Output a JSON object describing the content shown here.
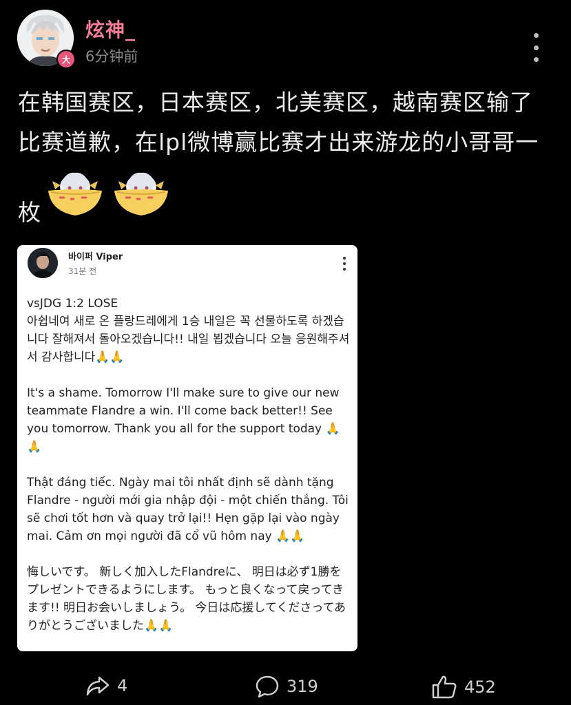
{
  "post": {
    "username": "炫神_",
    "time": "6分钟前",
    "badge": "大",
    "text": "在韩国赛区，日本赛区，北美赛区，越南赛区输了比赛道歉，在lpl微博赢比赛才出来游龙的小哥哥一",
    "text_tail": "枚",
    "emoji_icons": [
      "noodle-bowl-girl-icon",
      "noodle-bowl-girl-icon"
    ]
  },
  "card": {
    "name": "바이퍼 Viper",
    "time": "31분 전",
    "paragraphs": [
      "vsJDG 1:2 LOSE\n아쉽네여 새로 온 플랑드레에게 1승 내일은 꼭 선물하도록 하겠습니다 잘해져서 돌아오겠습니다!! 내일 뵙겠습니다 오늘 응원해주셔서 감사합니다🙏🙏",
      "It's a shame. Tomorrow I'll make sure to give our new teammate Flandre a win. I'll come back better!! See you tomorrow. Thank you all for the support today 🙏🙏",
      "Thật đáng tiếc. Ngày mai tôi nhất định sẽ dành tặng Flandre - người mới gia nhập đội - một chiến thắng. Tôi sẽ chơi tốt hơn và quay trở lại!! Hẹn gặp lại vào ngày mai. Cảm ơn mọi người đã cổ vũ hôm nay 🙏🙏",
      "悔しいです。 新しく加入したFlandreに、 明日は必ず1勝をプレゼントできるようにします。 もっと良くなって戻ってきます!! 明日お会いしましょう。 今日は応援してくださってありがとうございました🙏🙏"
    ]
  },
  "footer": {
    "share_count": "4",
    "comment_count": "319",
    "like_count": "452"
  }
}
